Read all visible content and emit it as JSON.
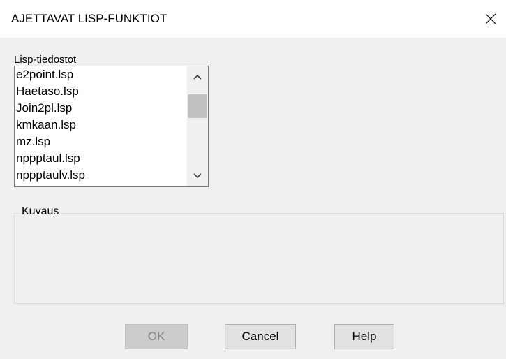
{
  "window": {
    "title": "AJETTAVAT LISP-FUNKTIOT",
    "close_icon": "close-icon"
  },
  "lisp_list": {
    "label": "Lisp-tiedostot",
    "items": [
      "e2point.lsp",
      "Haetaso.lsp",
      "Join2pl.lsp",
      "kmkaan.lsp",
      "mz.lsp",
      "nppptaul.lsp",
      "nppptaulv.lsp"
    ],
    "scroll_up_icon": "chevron-up-icon",
    "scroll_down_icon": "chevron-down-icon"
  },
  "description": {
    "label": "Kuvaus",
    "text": ""
  },
  "buttons": {
    "ok_label": "OK",
    "ok_enabled": false,
    "cancel_label": "Cancel",
    "help_label": "Help"
  },
  "colors": {
    "dialog_bg": "#f0f0f0",
    "titlebar_bg": "#ffffff",
    "disabled_text": "#838383"
  }
}
